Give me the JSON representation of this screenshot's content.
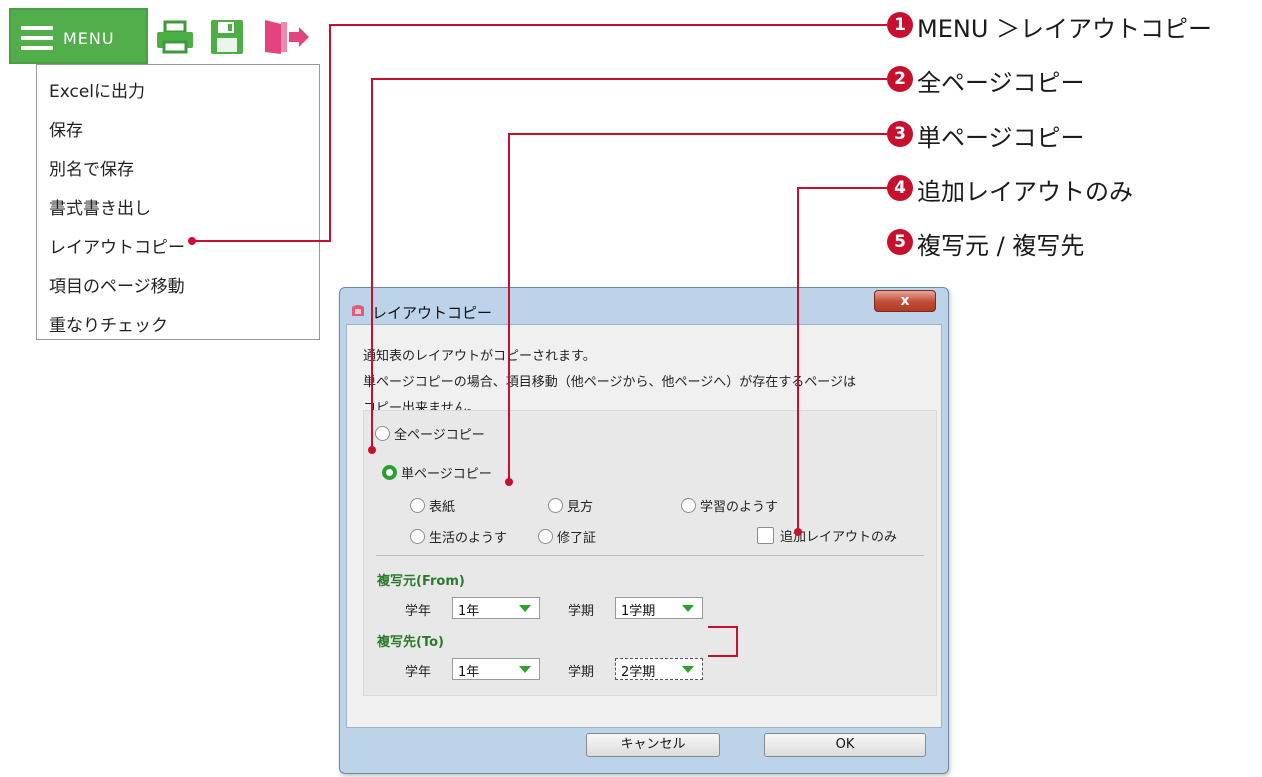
{
  "toolbar": {
    "menu_label": "MENU",
    "icons": [
      "print-icon",
      "save-icon",
      "exit-icon"
    ],
    "accent_color": "#52ae4a"
  },
  "menu": {
    "items": [
      "Excelに出力",
      "保存",
      "別名で保存",
      "書式書き出し",
      "レイアウトコピー",
      "項目のページ移動",
      "重なりチェック"
    ]
  },
  "callouts": [
    {
      "num": "1",
      "text": "MENU ＞レイアウトコピー"
    },
    {
      "num": "2",
      "text": "全ページコピー"
    },
    {
      "num": "3",
      "text": "単ページコピー"
    },
    {
      "num": "4",
      "text": "追加レイアウトのみ"
    },
    {
      "num": "5",
      "text": "複写元 / 複写先"
    }
  ],
  "dialog": {
    "title": "レイアウトコピー",
    "close_glyph": "x",
    "description": [
      "通知表のレイアウトがコピーされます。",
      "単ページコピーの場合、項目移動（他ページから、他ページへ）が存在するページは",
      "コピー出来ません。"
    ],
    "all_pages_label": "全ページコピー",
    "single_page_label": "単ページコピー",
    "single_page_selected": true,
    "pages": [
      "表紙",
      "見方",
      "学習のようす",
      "生活のようす",
      "修了証"
    ],
    "add_layout_only_label": "追加レイアウトのみ",
    "add_layout_only_checked": false,
    "from_label": "複写元(From)",
    "to_label": "複写先(To)",
    "grade_label": "学年",
    "term_label": "学期",
    "from_grade": "1年",
    "from_term": "1学期",
    "to_grade": "1年",
    "to_term": "2学期",
    "cancel_label": "キャンセル",
    "ok_label": "OK"
  }
}
